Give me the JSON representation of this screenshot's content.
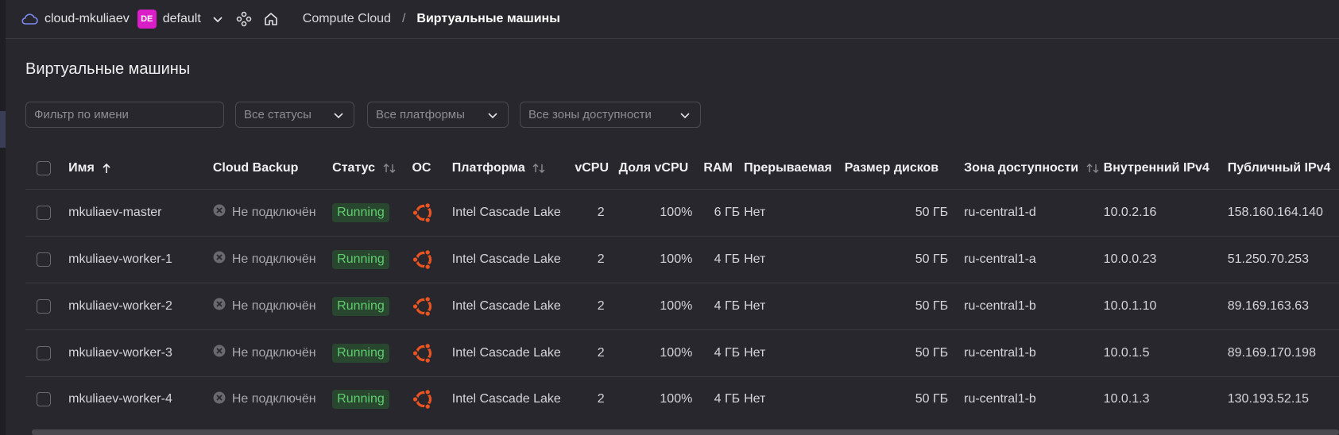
{
  "header": {
    "cloud_name": "cloud-mkuliaev",
    "folder_badge": "DE",
    "folder_name": "default",
    "service": "Compute Cloud",
    "separator": "/",
    "current_page": "Виртуальные машины"
  },
  "page": {
    "title": "Виртуальные машины"
  },
  "filters": {
    "name_placeholder": "Фильтр по имени",
    "status": "Все статусы",
    "platform": "Все платформы",
    "zone": "Все зоны доступности"
  },
  "table": {
    "columns": {
      "name": "Имя",
      "backup": "Cloud Backup",
      "status": "Статус",
      "os": "ОС",
      "platform": "Платформа",
      "vcpu": "vCPU",
      "vcpu_share": "Доля vCPU",
      "ram": "RAM",
      "preemptible": "Прерываемая",
      "disk_size": "Размер дисков",
      "zone": "Зона доступности",
      "internal_ip": "Внутренний IPv4",
      "public_ip": "Публичный IPv4"
    },
    "rows": [
      {
        "name": "mkuliaev-master",
        "backup": "Не подключён",
        "status": "Running",
        "os": "ubuntu-icon",
        "platform": "Intel Cascade Lake",
        "vcpu": "2",
        "vcpu_share": "100%",
        "ram": "6 ГБ",
        "preemptible": "Нет",
        "disk_size": "50 ГБ",
        "zone": "ru-central1-d",
        "internal_ip": "10.0.2.16",
        "public_ip": "158.160.164.140"
      },
      {
        "name": "mkuliaev-worker-1",
        "backup": "Не подключён",
        "status": "Running",
        "os": "ubuntu-icon",
        "platform": "Intel Cascade Lake",
        "vcpu": "2",
        "vcpu_share": "100%",
        "ram": "4 ГБ",
        "preemptible": "Нет",
        "disk_size": "50 ГБ",
        "zone": "ru-central1-a",
        "internal_ip": "10.0.0.23",
        "public_ip": "51.250.70.253"
      },
      {
        "name": "mkuliaev-worker-2",
        "backup": "Не подключён",
        "status": "Running",
        "os": "ubuntu-icon",
        "platform": "Intel Cascade Lake",
        "vcpu": "2",
        "vcpu_share": "100%",
        "ram": "4 ГБ",
        "preemptible": "Нет",
        "disk_size": "50 ГБ",
        "zone": "ru-central1-b",
        "internal_ip": "10.0.1.10",
        "public_ip": "89.169.163.63"
      },
      {
        "name": "mkuliaev-worker-3",
        "backup": "Не подключён",
        "status": "Running",
        "os": "ubuntu-icon",
        "platform": "Intel Cascade Lake",
        "vcpu": "2",
        "vcpu_share": "100%",
        "ram": "4 ГБ",
        "preemptible": "Нет",
        "disk_size": "50 ГБ",
        "zone": "ru-central1-b",
        "internal_ip": "10.0.1.5",
        "public_ip": "89.169.170.198"
      },
      {
        "name": "mkuliaev-worker-4",
        "backup": "Не подключён",
        "status": "Running",
        "os": "ubuntu-icon",
        "platform": "Intel Cascade Lake",
        "vcpu": "2",
        "vcpu_share": "100%",
        "ram": "4 ГБ",
        "preemptible": "Нет",
        "disk_size": "50 ГБ",
        "zone": "ru-central1-b",
        "internal_ip": "10.0.1.3",
        "public_ip": "130.193.52.15"
      }
    ]
  },
  "colors": {
    "background": "#28272d",
    "folder_badge": "#d91ec7",
    "status_running_bg": "#29472f",
    "status_running_text": "#5fcf6e",
    "ubuntu_orange": "#e95420"
  }
}
